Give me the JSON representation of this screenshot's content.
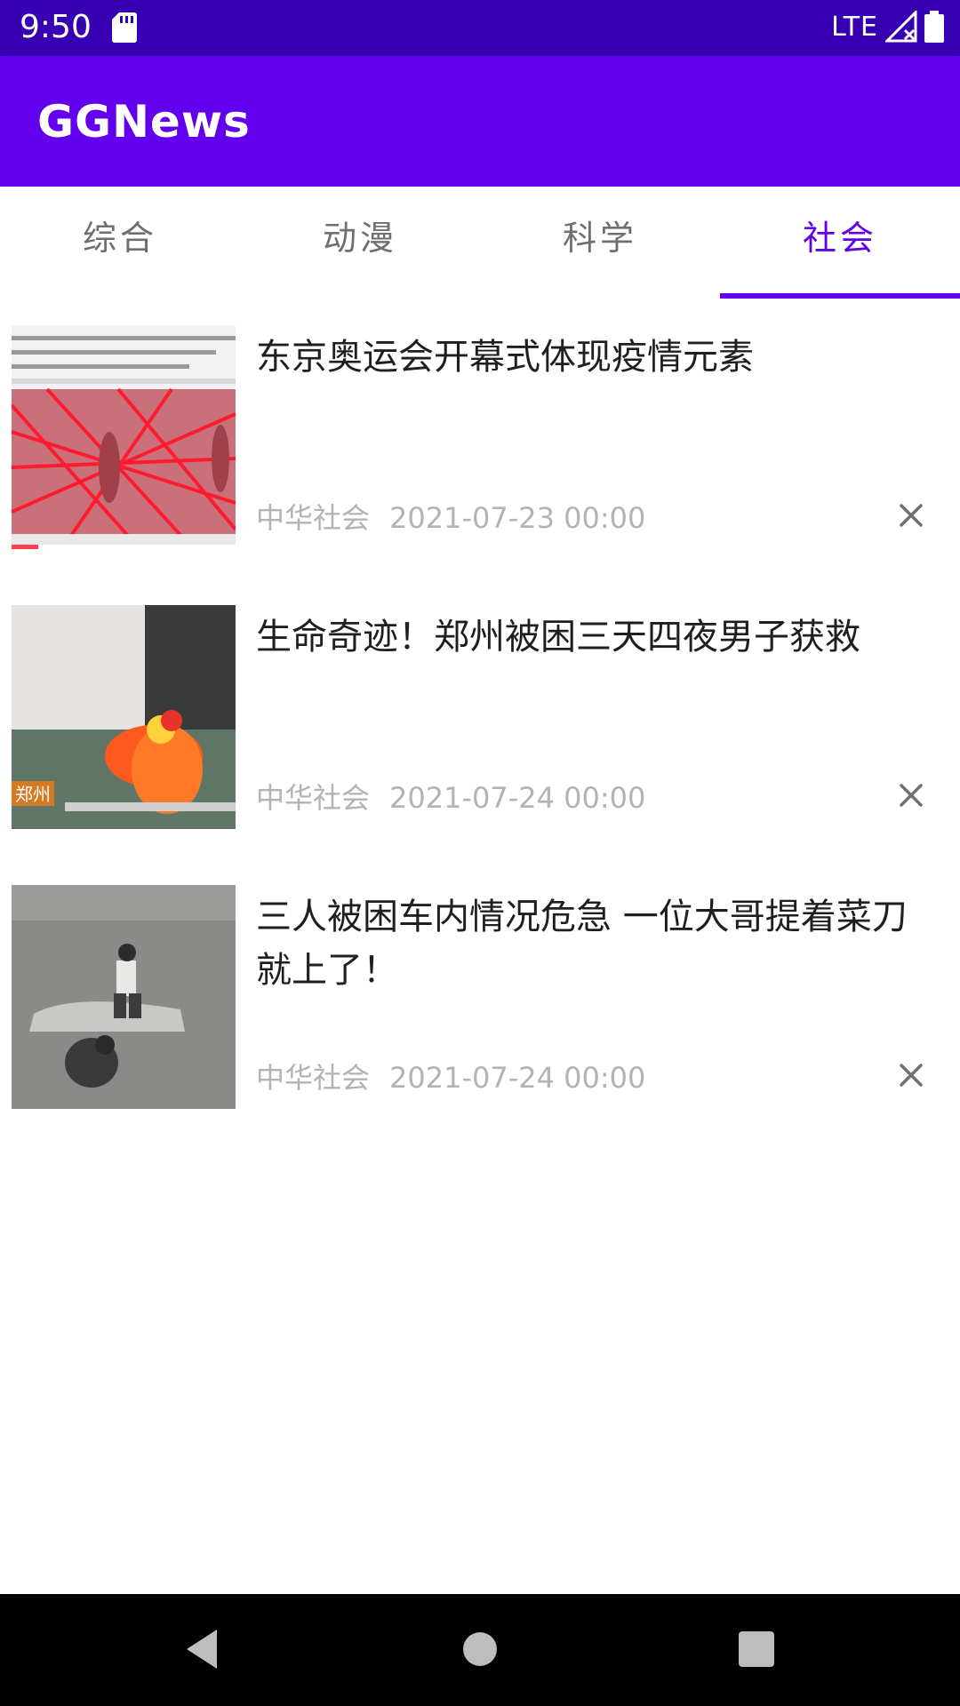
{
  "status_bar": {
    "time": "9:50",
    "network": "LTE",
    "icons": [
      "sd-card-icon",
      "signal-icon",
      "battery-icon"
    ]
  },
  "app_bar": {
    "title": "GGNews",
    "color": "#6200ee"
  },
  "tabs": [
    {
      "label": "综合",
      "active": false
    },
    {
      "label": "动漫",
      "active": false
    },
    {
      "label": "科学",
      "active": false
    },
    {
      "label": "社会",
      "active": true
    }
  ],
  "news": [
    {
      "title": "东京奥运会开幕式体现疫情元素",
      "source": "中华社会",
      "date": "2021-07-23 00:00"
    },
    {
      "title": "生命奇迹！郑州被困三天四夜男子获救",
      "source": "中华社会",
      "date": "2021-07-24 00:00",
      "thumb_caption": "郑州"
    },
    {
      "title": "三人被困车内情况危急 一位大哥提着菜刀就上了！",
      "source": "中华社会",
      "date": "2021-07-24 00:00"
    }
  ],
  "nav_bar": {
    "icons": [
      "back-icon",
      "home-icon",
      "recents-icon"
    ]
  }
}
